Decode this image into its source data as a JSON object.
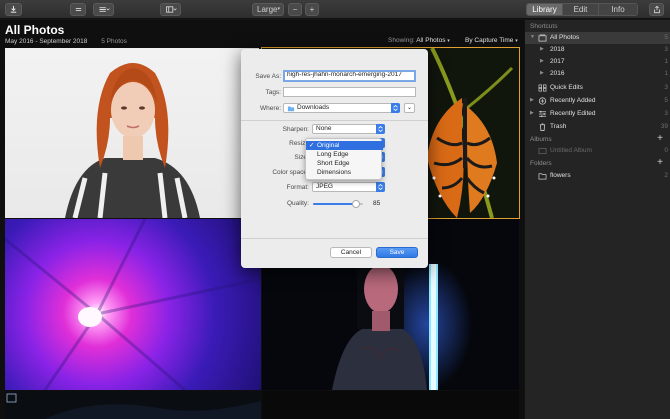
{
  "toolbar": {
    "zoom_label": "Large",
    "zoom_out": "−",
    "zoom_in": "+",
    "tabs": [
      {
        "label": "Library",
        "active": true
      },
      {
        "label": "Edit",
        "active": false
      },
      {
        "label": "Info",
        "active": false
      }
    ]
  },
  "header": {
    "title": "All Photos",
    "date_range": "May 2016 - September 2018",
    "count": "5 Photos",
    "showing_label": "Showing:",
    "showing_value": "All Photos",
    "sort_value": "By Capture Time"
  },
  "sidebar": {
    "shortcuts_label": "Shortcuts",
    "albums_label": "Albums",
    "folders_label": "Folders",
    "items": [
      {
        "label": "All Photos",
        "count": "5"
      },
      {
        "label": "2018",
        "count": "3"
      },
      {
        "label": "2017",
        "count": "1"
      },
      {
        "label": "2016",
        "count": "1"
      },
      {
        "label": "Quick Edits",
        "count": "3"
      },
      {
        "label": "Recently Added",
        "count": "5"
      },
      {
        "label": "Recently Edited",
        "count": "3"
      },
      {
        "label": "Trash",
        "count": "39"
      }
    ],
    "albums": [
      {
        "label": "Untitled Album",
        "count": "0"
      }
    ],
    "folders": [
      {
        "label": "flowers",
        "count": "2"
      }
    ]
  },
  "dialog": {
    "save_as_label": "Save As:",
    "save_as_value": "high-res-jhahn-monarch-emerging-2017",
    "tags_label": "Tags:",
    "tags_value": "",
    "where_label": "Where:",
    "where_value": "Downloads",
    "sharpen_label": "Sharpen:",
    "sharpen_value": "None",
    "resize_label": "Resize",
    "size_label": "Size",
    "color_space_label": "Color space",
    "format_label": "Format:",
    "format_value": "JPEG",
    "quality_label": "Quality:",
    "quality_value": "85",
    "quality_level": 0.85,
    "cancel_label": "Cancel",
    "save_label": "Save",
    "resize_menu": [
      {
        "label": "Original",
        "checked": true
      },
      {
        "label": "Long Edge",
        "checked": false
      },
      {
        "label": "Short Edge",
        "checked": false
      },
      {
        "label": "Dimensions",
        "checked": false
      }
    ]
  },
  "colors": {
    "accent": "#2f78e6",
    "selection_outline": "#e0a030"
  }
}
